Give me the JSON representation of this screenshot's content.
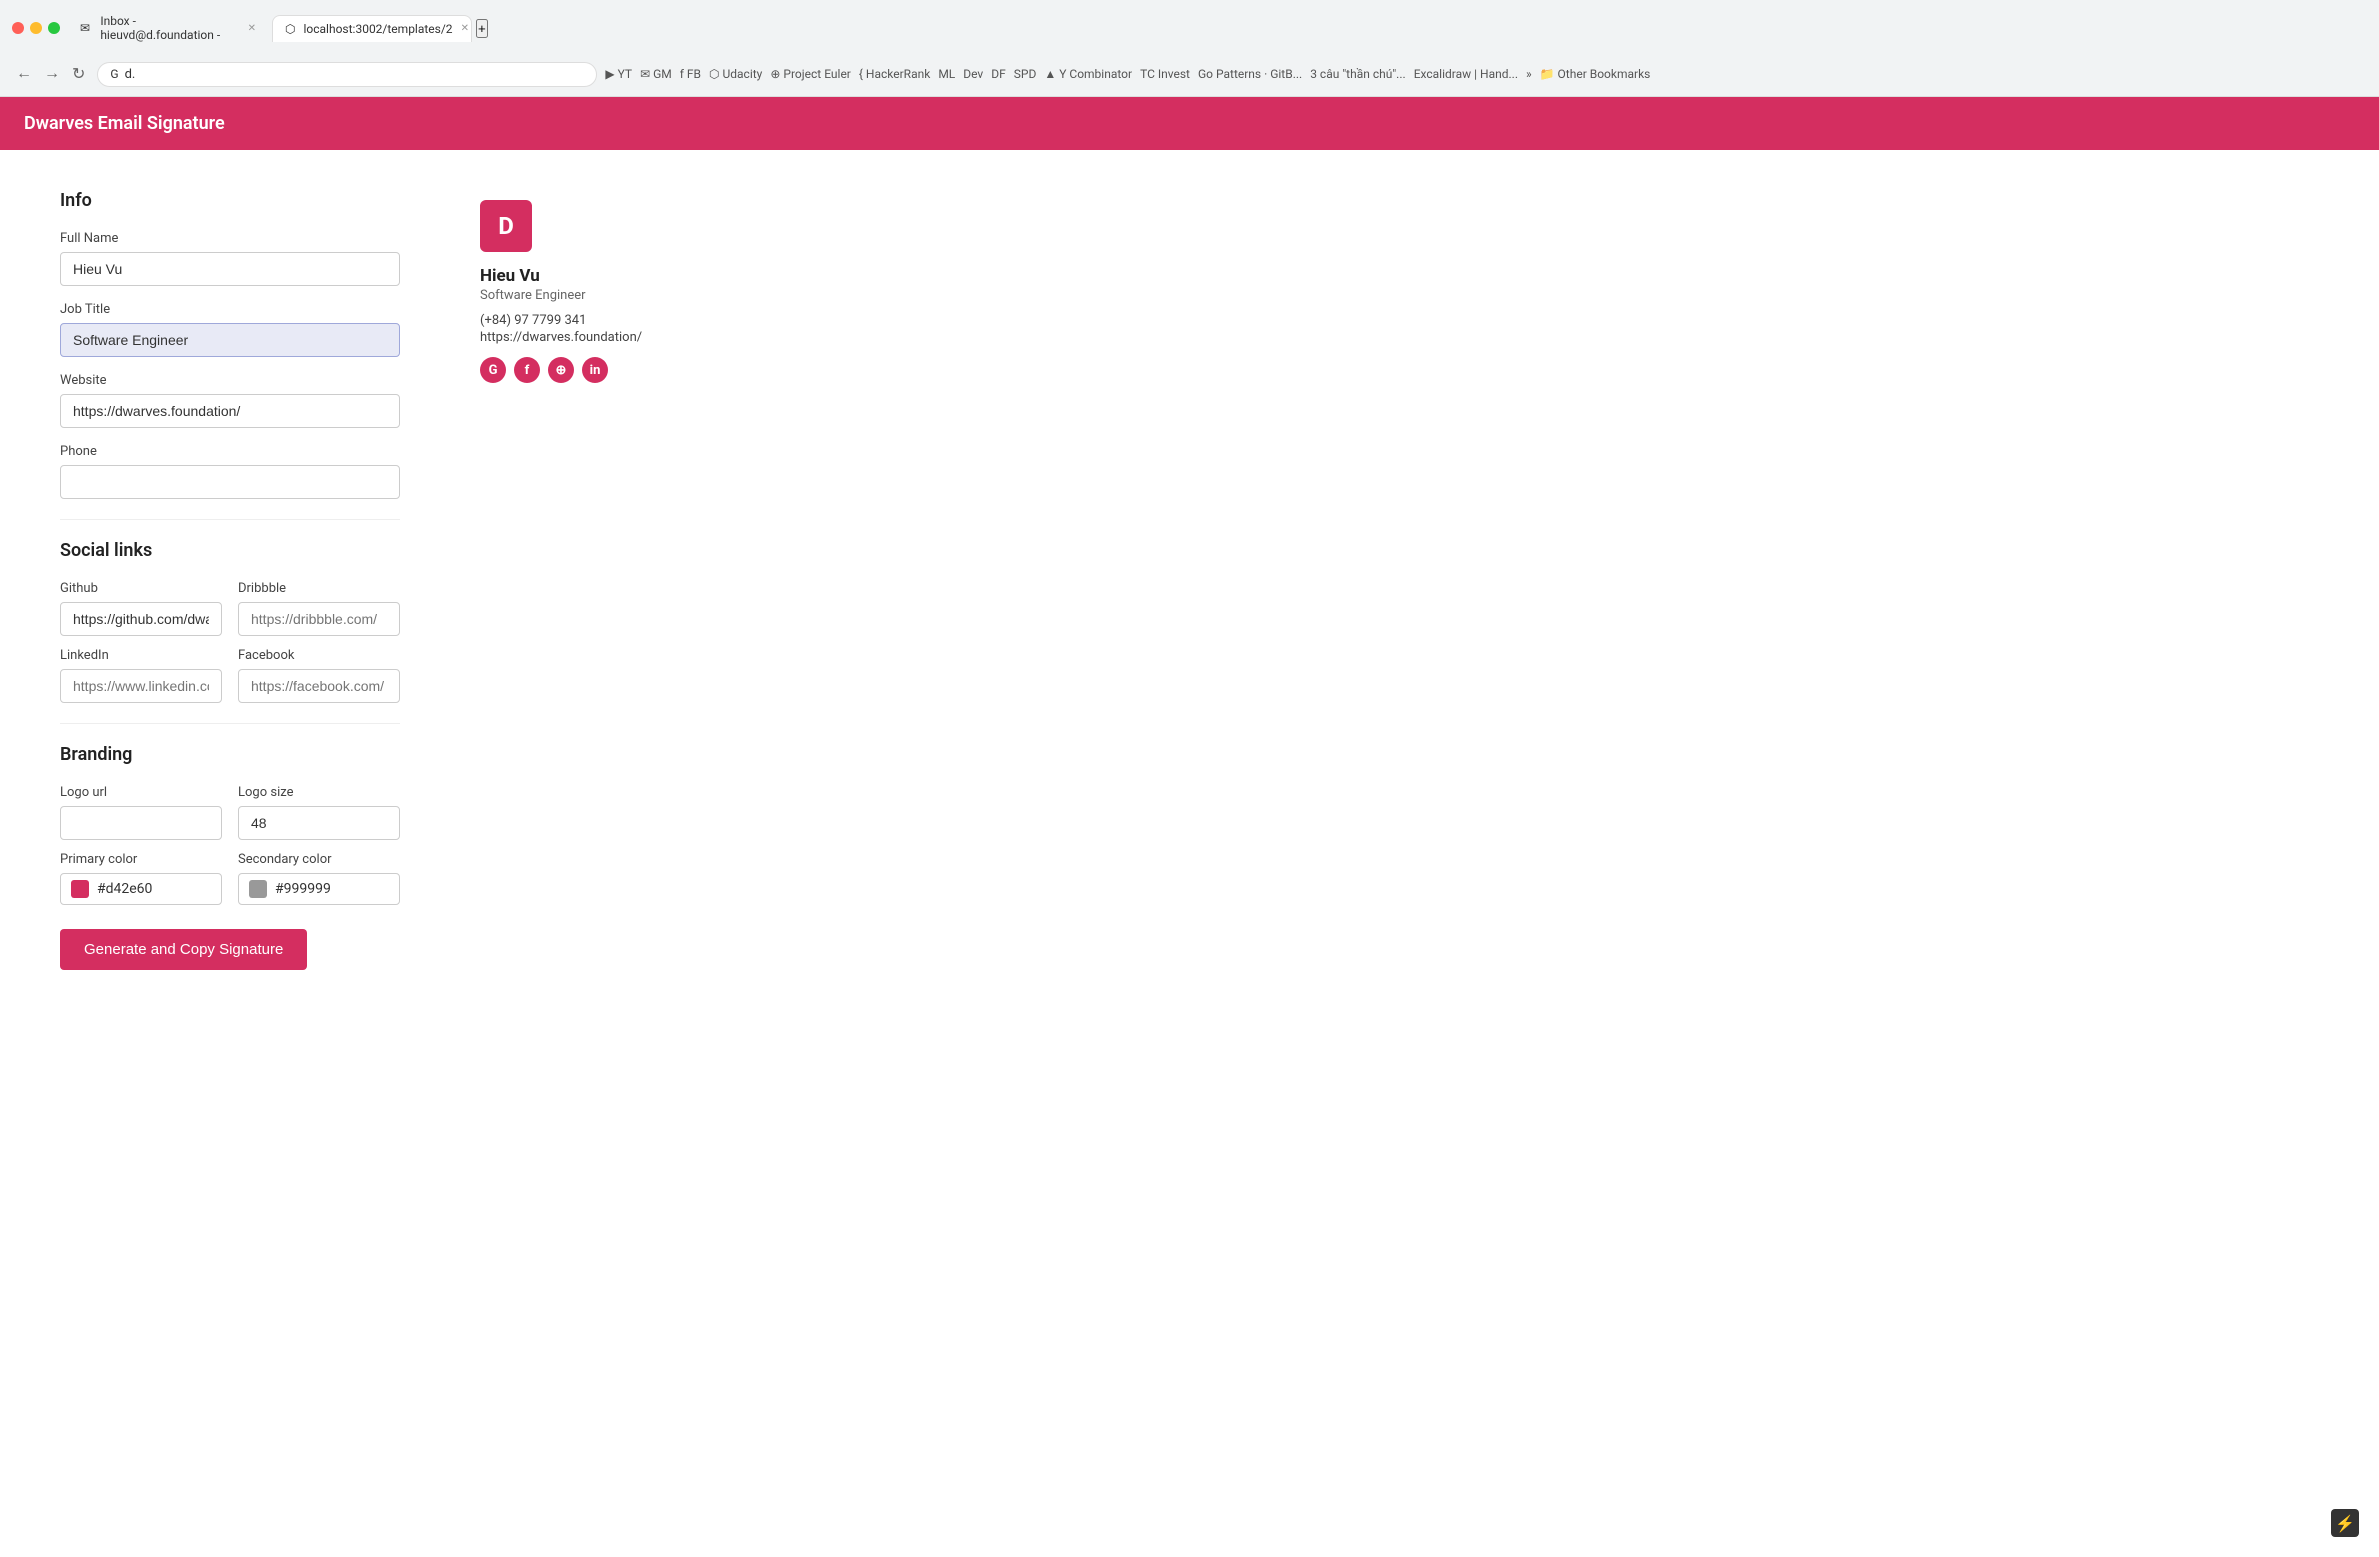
{
  "browser": {
    "tabs": [
      {
        "id": "gmail",
        "label": "Inbox - hieuvd@d.foundation -",
        "favicon": "✉",
        "active": false
      },
      {
        "id": "app",
        "label": "localhost:3002/templates/2",
        "favicon": "⬡",
        "active": true
      }
    ],
    "url": "d.",
    "bookmarks": [
      "YT",
      "GM",
      "FB",
      "Udacity",
      "Project Euler",
      "HackerRank",
      "ML",
      "Dev",
      "DF",
      "SPD",
      "Y Combinator",
      "TCInvest",
      "Go Patterns · GitB...",
      "3 câu \"thần chú\"...",
      "Excalidraw | Hand...",
      "»",
      "Other Bookmarks"
    ]
  },
  "app": {
    "title": "Dwarves Email Signature"
  },
  "form": {
    "info_title": "Info",
    "full_name_label": "Full Name",
    "full_name_value": "Hieu Vu",
    "job_title_label": "Job Title",
    "job_title_value": "Software Engineer",
    "website_label": "Website",
    "website_value": "https://dwarves.foundation/",
    "phone_label": "Phone",
    "phone_value": "",
    "social_links_title": "Social links",
    "github_label": "Github",
    "github_value": "https://github.com/dwar",
    "dribbble_label": "Dribbble",
    "dribbble_placeholder": "https://dribbble.com/",
    "linkedin_label": "LinkedIn",
    "linkedin_placeholder": "https://www.linkedin.con",
    "facebook_label": "Facebook",
    "facebook_placeholder": "https://facebook.com/",
    "branding_title": "Branding",
    "logo_url_label": "Logo url",
    "logo_url_value": "",
    "logo_size_label": "Logo size",
    "logo_size_value": "48",
    "primary_color_label": "Primary color",
    "primary_color_value": "#d42e60",
    "secondary_color_label": "Secondary color",
    "secondary_color_value": "#999999",
    "generate_btn_label": "Generate and Copy Signature"
  },
  "preview": {
    "name": "Hieu Vu",
    "job_title": "Software Engineer",
    "phone": "(+84) 97 7799 341",
    "website": "https://dwarves.foundation/",
    "logo_text": "D",
    "socials": [
      "G",
      "f",
      "⊕",
      "in"
    ]
  }
}
